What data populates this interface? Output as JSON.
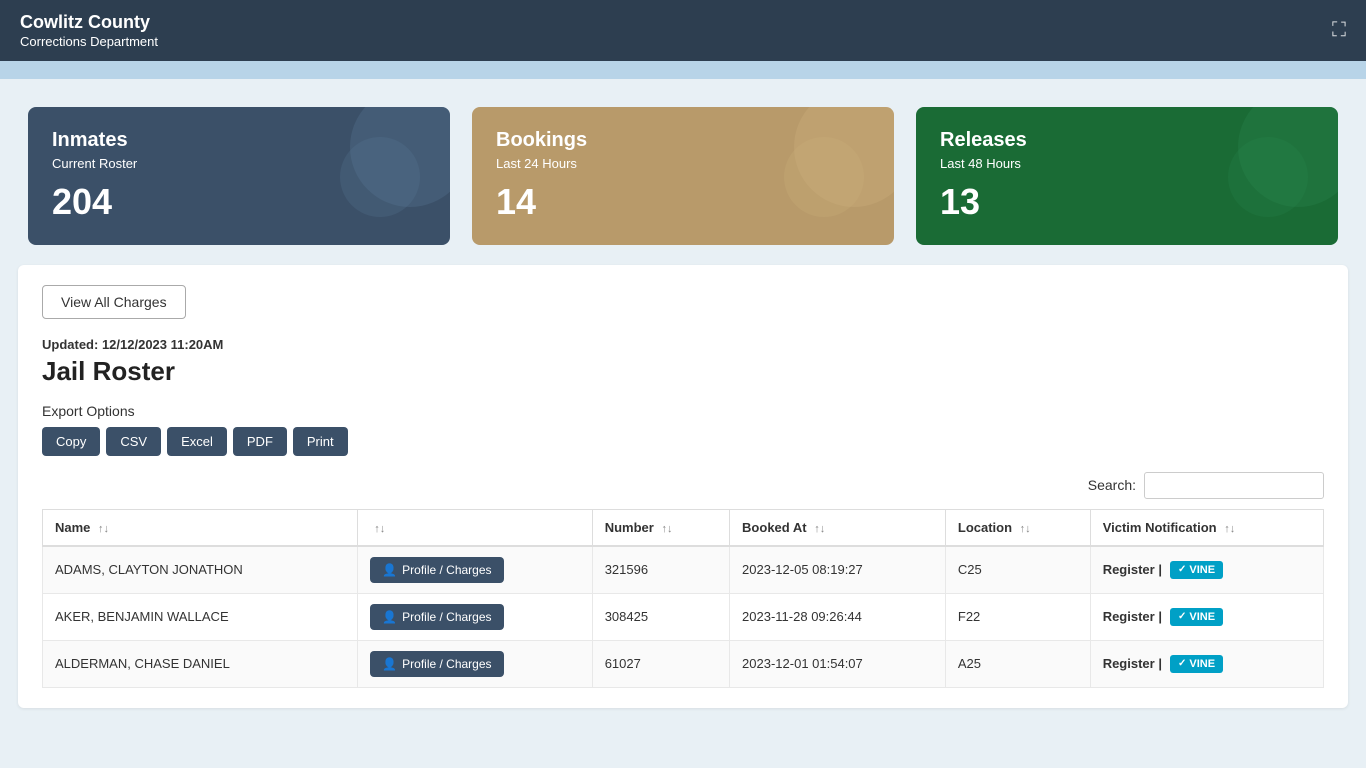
{
  "header": {
    "title": "Cowlitz County",
    "subtitle": "Corrections Department",
    "icon": "⛶"
  },
  "stats": {
    "inmates": {
      "label": "Inmates",
      "sublabel": "Current Roster",
      "number": "204"
    },
    "bookings": {
      "label": "Bookings",
      "sublabel": "Last 24 Hours",
      "number": "14"
    },
    "releases": {
      "label": "Releases",
      "sublabel": "Last 48 Hours",
      "number": "13"
    }
  },
  "main": {
    "view_all_label": "View All Charges",
    "updated_text": "Updated: 12/12/2023 11:20AM",
    "roster_title": "Jail Roster",
    "export_label": "Export Options",
    "export_buttons": [
      "Copy",
      "CSV",
      "Excel",
      "PDF",
      "Print"
    ],
    "search_label": "Search:",
    "search_placeholder": "",
    "table": {
      "headers": [
        "Name",
        "",
        "Number",
        "Booked At",
        "Location",
        "Victim Notification"
      ],
      "rows": [
        {
          "name": "ADAMS, CLAYTON JONATHON",
          "number": "321596",
          "booked_at": "2023-12-05 08:19:27",
          "location": "C25",
          "register": "Register |"
        },
        {
          "name": "AKER, BENJAMIN WALLACE",
          "number": "308425",
          "booked_at": "2023-11-28 09:26:44",
          "location": "F22",
          "register": "Register |"
        },
        {
          "name": "ALDERMAN, CHASE DANIEL",
          "number": "61027",
          "booked_at": "2023-12-01 01:54:07",
          "location": "A25",
          "register": "Register |"
        }
      ],
      "profile_btn_label": "Profile / Charges",
      "vine_label": "VINE"
    }
  }
}
